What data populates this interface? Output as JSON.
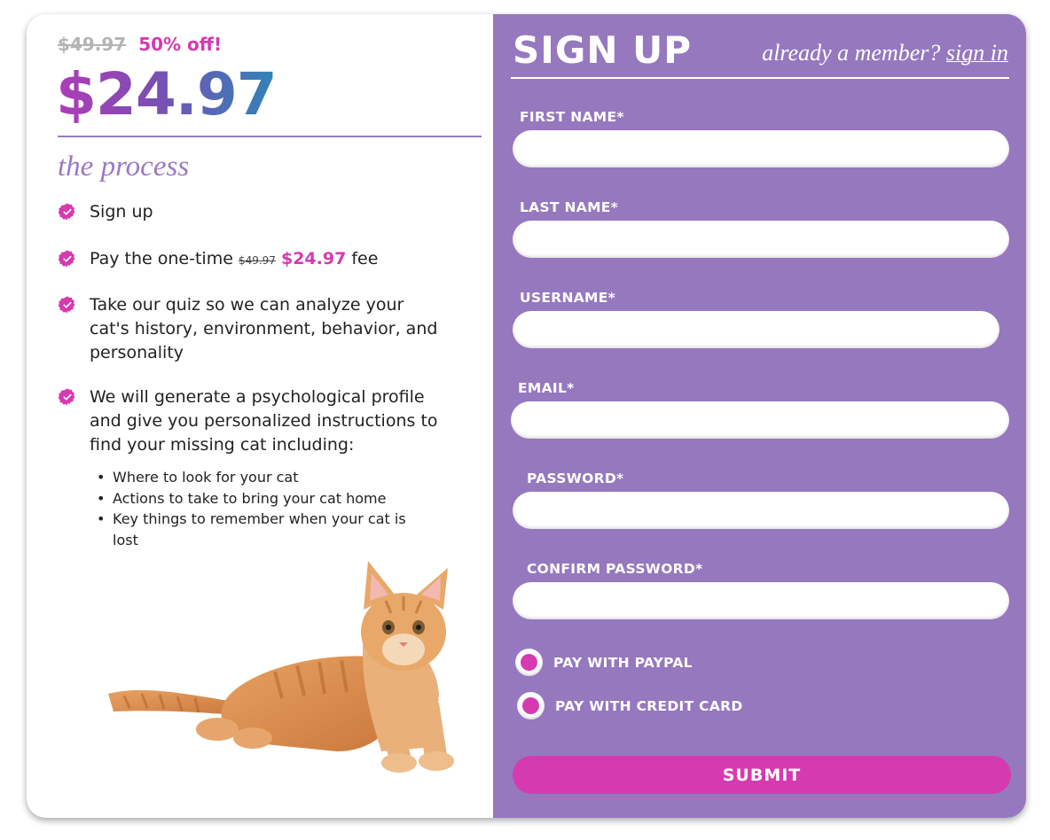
{
  "pricing": {
    "original_price": "$49.97",
    "discount_label": "50% off!",
    "current_price": "$24.97"
  },
  "process": {
    "title": "the process",
    "steps": [
      {
        "text": "Sign up"
      },
      {
        "text_before": "Pay the one-time",
        "old_fee": "$49.97",
        "new_fee": "$24.97",
        "text_after": "fee"
      },
      {
        "text": "Take our quiz so we can analyze your cat's history, environment, behavior, and personality"
      },
      {
        "text": "We will generate a psychological profile and give you personalized instructions to find your missing cat including:",
        "sub_items": [
          "Where to look for your cat",
          "Actions to take to bring your cat home",
          "Key things to remember when your cat is lost"
        ]
      }
    ]
  },
  "signup": {
    "title": "SIGN UP",
    "member_prompt": "already a member?",
    "sign_in_label": "sign in",
    "fields": {
      "first_name": {
        "label": "FIRST NAME*",
        "value": ""
      },
      "last_name": {
        "label": "LAST NAME*",
        "value": ""
      },
      "username": {
        "label": "USERNAME*",
        "value": ""
      },
      "email": {
        "label": "EMAIL*",
        "value": ""
      },
      "password": {
        "label": "PASSWORD*",
        "value": ""
      },
      "confirm_password": {
        "label": "CONFIRM PASSWORD*",
        "value": ""
      }
    },
    "payment_options": [
      {
        "label": "PAY WITH PAYPAL"
      },
      {
        "label": "PAY WITH CREDIT CARD"
      }
    ],
    "submit_label": "SUBMIT"
  },
  "icons": {
    "step_check": "check-badge-icon",
    "cat_image": "cat-illustration"
  },
  "colors": {
    "accent_pink": "#d63ab0",
    "panel_purple": "#9678bf",
    "process_purple": "#9a7ac4",
    "price_gradient_start": "#b03cb8",
    "price_gradient_end": "#2f84b8"
  }
}
